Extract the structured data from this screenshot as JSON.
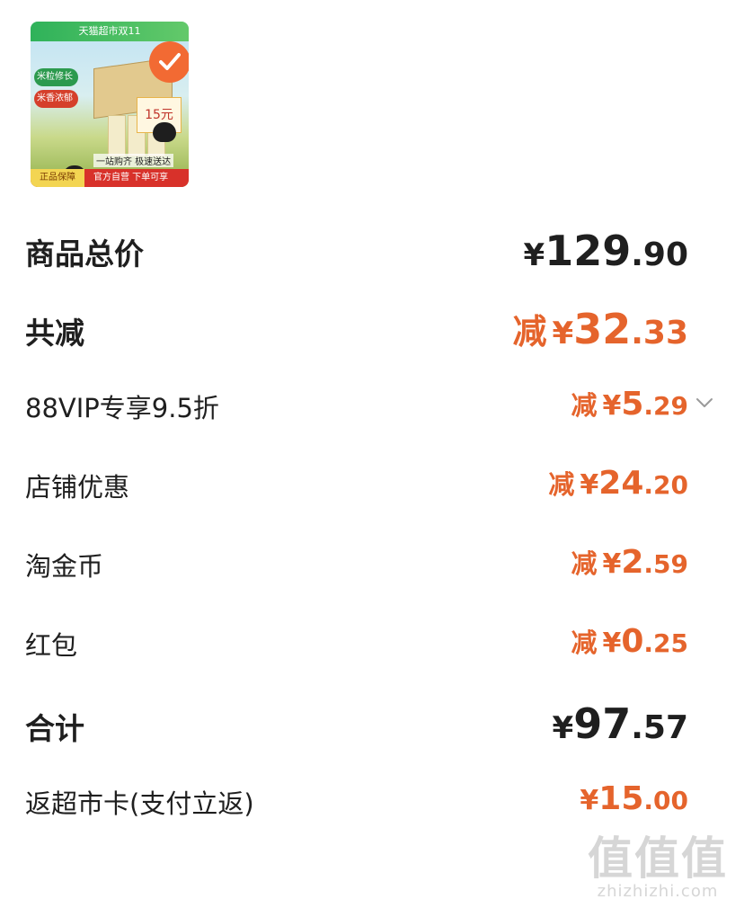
{
  "product": {
    "banner": "天猫超市双11",
    "tag1": "米粒修长",
    "tag2": "米香浓郁",
    "price_tag": "15元",
    "slogan": "一站购齐 极速送达",
    "bottom_left": "正品保障",
    "bottom_right": "官方自营 下单可享"
  },
  "summary": {
    "total": {
      "label": "商品总价",
      "currency": "¥",
      "int": "129",
      "dec": ".90"
    },
    "discount": {
      "label": "共减",
      "prefix": "减",
      "currency": "¥",
      "int": "32",
      "dec": ".33"
    },
    "items": [
      {
        "label": "88VIP专享9.5折",
        "prefix": "减",
        "currency": "¥",
        "int": "5",
        "dec": ".29",
        "expandable": true
      },
      {
        "label": "店铺优惠",
        "prefix": "减",
        "currency": "¥",
        "int": "24",
        "dec": ".20"
      },
      {
        "label": "淘金币",
        "prefix": "减",
        "currency": "¥",
        "int": "2",
        "dec": ".59"
      },
      {
        "label": "红包",
        "prefix": "减",
        "currency": "¥",
        "int": "0",
        "dec": ".25"
      }
    ],
    "grand_total": {
      "label": "合计",
      "currency": "¥",
      "int": "97",
      "dec": ".57"
    },
    "cashback": {
      "label": "返超市卡(支付立返)",
      "currency": "¥",
      "int": "15",
      "dec": ".00"
    }
  },
  "watermark": {
    "text": "值值值",
    "domain": "zhizhizhi.com"
  },
  "colors": {
    "accent": "#e5642c",
    "text": "#1f1f1f"
  },
  "icons": {
    "expand": "chevron-down-icon",
    "selected": "check-circle-icon"
  }
}
